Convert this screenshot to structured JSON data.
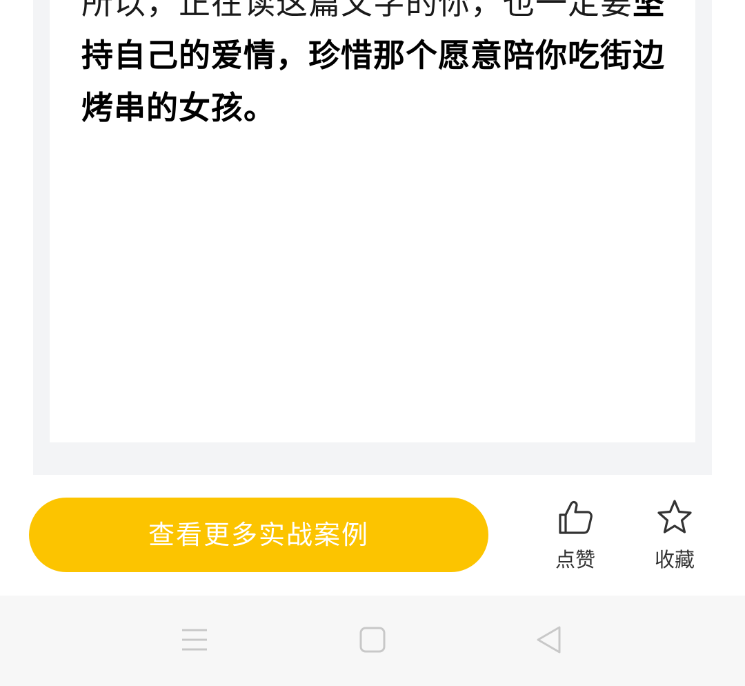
{
  "article": {
    "line1_normal": "所以，正在读这篇文字的你，也一定要",
    "line1_strong": "坚",
    "line2_strong": "持自己的爱情，珍惜那个愿意陪你吃街边",
    "line3_strong": "烤串的女孩。"
  },
  "footer": {
    "cta_label": "查看更多实战案例",
    "like_label": "点赞",
    "favorite_label": "收藏"
  },
  "colors": {
    "cta_background": "#fcc400",
    "cta_text": "#ffffff",
    "frame_gray": "#f3f4f6",
    "nav_bar": "#f7f7f7"
  },
  "icons": {
    "like": "thumbs-up-icon",
    "favorite": "star-icon",
    "nav_menu": "menu-icon",
    "nav_home": "square-home-icon",
    "nav_back": "triangle-back-icon"
  }
}
